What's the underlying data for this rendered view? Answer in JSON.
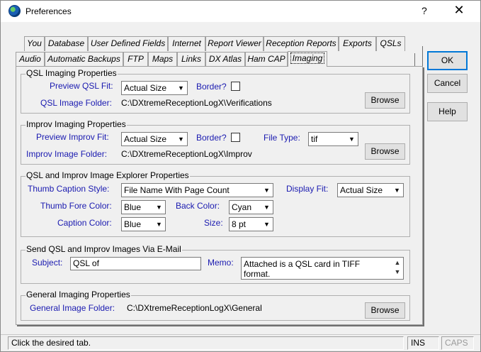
{
  "window": {
    "title": "Preferences",
    "help_glyph": "?",
    "close_glyph": "✕"
  },
  "tabs": {
    "row1": [
      "You",
      "Database",
      "User Defined Fields",
      "Internet",
      "Report Viewer",
      "Reception Reports",
      "Exports",
      "QSLs"
    ],
    "row2": [
      "Audio",
      "Automatic Backups",
      "FTP",
      "Maps",
      "Links",
      "DX Atlas",
      "Ham CAP",
      "Imaging"
    ],
    "active": "Imaging"
  },
  "qsl_group": {
    "title": "QSL Imaging Properties",
    "preview_fit_label": "Preview QSL Fit:",
    "preview_fit_value": "Actual Size",
    "border_label": "Border?",
    "folder_label": "QSL Image Folder:",
    "folder_value": "C:\\DXtremeReceptionLogX\\Verifications",
    "browse_label": "Browse"
  },
  "improv_group": {
    "title": "Improv Imaging Properties",
    "preview_fit_label": "Preview Improv Fit:",
    "preview_fit_value": "Actual Size",
    "border_label": "Border?",
    "file_type_label": "File Type:",
    "file_type_value": "tif",
    "folder_label": "Improv Image Folder:",
    "folder_value": "C:\\DXtremeReceptionLogX\\Improv",
    "browse_label": "Browse"
  },
  "explorer_group": {
    "title": "QSL and Improv Image Explorer Properties",
    "thumb_caption_label": "Thumb Caption Style:",
    "thumb_caption_value": "File Name With Page Count",
    "display_fit_label": "Display Fit:",
    "display_fit_value": "Actual Size",
    "thumb_fore_label": "Thumb Fore Color:",
    "thumb_fore_value": "Blue",
    "back_color_label": "Back Color:",
    "back_color_value": "Cyan",
    "caption_color_label": "Caption Color:",
    "caption_color_value": "Blue",
    "size_label": "Size:",
    "size_value": "8 pt"
  },
  "email_group": {
    "title": "Send QSL and Improv Images Via E-Mail",
    "subject_label": "Subject:",
    "subject_value": "QSL of",
    "memo_label": "Memo:",
    "memo_value": "Attached is a QSL card in TIFF format."
  },
  "general_group": {
    "title": "General Imaging Properties",
    "folder_label": "General Image Folder:",
    "folder_value": "C:\\DXtremeReceptionLogX\\General",
    "browse_label": "Browse"
  },
  "side_buttons": {
    "ok": "OK",
    "cancel": "Cancel",
    "help": "Help"
  },
  "status": {
    "message": "Click the desired tab.",
    "ins": "INS",
    "caps": "CAPS"
  },
  "colors": {
    "label_blue": "#1a1ab0",
    "default_button_border": "#0078d7"
  },
  "icons": {
    "app": "globe-icon",
    "dropdown": "chevron-down-icon",
    "scroll_up": "chevron-up-icon",
    "scroll_down": "chevron-down-icon"
  }
}
